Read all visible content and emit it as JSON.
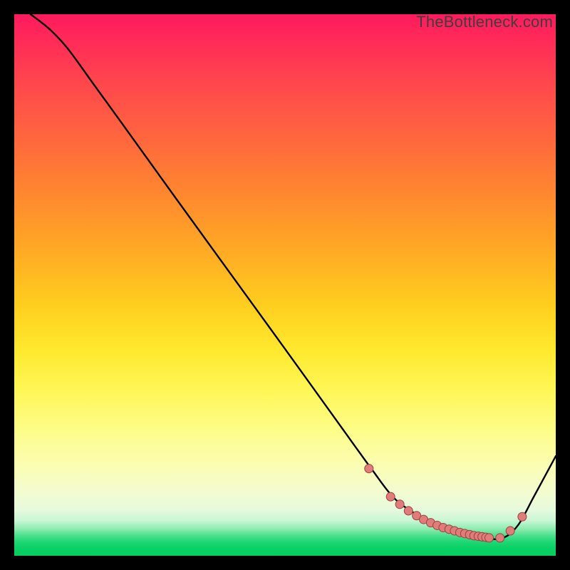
{
  "watermark": "TheBottleneck.com",
  "chart_data": {
    "type": "line",
    "title": "",
    "xlabel": "",
    "ylabel": "",
    "xlim": [
      0,
      100
    ],
    "ylim": [
      0,
      100
    ],
    "series": [
      {
        "name": "curve",
        "x": [
          3,
          5,
          7,
          10,
          15,
          20,
          30,
          40,
          50,
          60,
          66,
          70,
          74,
          78,
          82,
          86,
          90,
          93,
          96,
          100
        ],
        "y": [
          100,
          98.5,
          96.8,
          93.5,
          86.6,
          79.7,
          65.8,
          52.0,
          38.2,
          24.3,
          16.0,
          10.8,
          7.8,
          5.8,
          4.2,
          3.4,
          3.2,
          5.6,
          11.0,
          18.4
        ]
      },
      {
        "name": "markers",
        "x": [
          65.5,
          69.5,
          71.2,
          72.8,
          74.3,
          75.6,
          76.9,
          78.1,
          79.2,
          80.3,
          81.3,
          82.3,
          83.2,
          84.1,
          84.9,
          85.7,
          86.4,
          87.1,
          87.7,
          89.7,
          91.6,
          93.8
        ],
        "y": [
          16.1,
          10.9,
          9.5,
          8.3,
          7.4,
          6.7,
          6.1,
          5.6,
          5.2,
          4.9,
          4.6,
          4.3,
          4.1,
          3.9,
          3.7,
          3.6,
          3.5,
          3.4,
          3.3,
          3.3,
          4.6,
          7.2
        ]
      }
    ],
    "colors": {
      "curve": "#000000",
      "markers_fill": "#e07d7a",
      "markers_stroke": "#99413f"
    }
  }
}
